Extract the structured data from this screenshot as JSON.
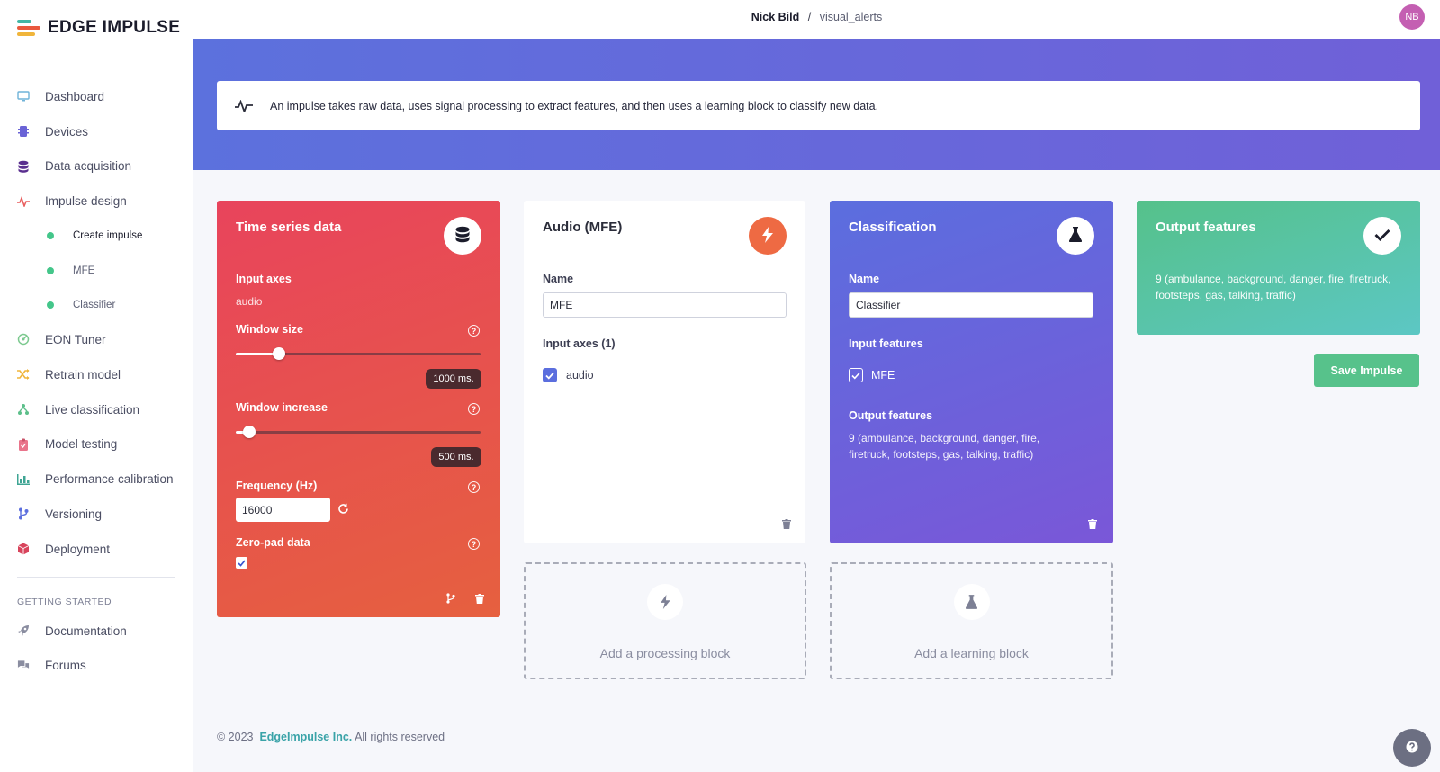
{
  "app": {
    "logo_text": "EDGE IMPULSE"
  },
  "nav": {
    "items": [
      {
        "label": "Dashboard",
        "icon": "monitor-icon"
      },
      {
        "label": "Devices",
        "icon": "chip-icon"
      },
      {
        "label": "Data acquisition",
        "icon": "database-icon"
      },
      {
        "label": "Impulse design",
        "icon": "pulse-icon"
      }
    ],
    "sub_items": [
      {
        "label": "Create impulse",
        "active": true
      },
      {
        "label": "MFE",
        "active": false
      },
      {
        "label": "Classifier",
        "active": false
      }
    ],
    "items2": [
      {
        "label": "EON Tuner",
        "icon": "target-icon"
      },
      {
        "label": "Retrain model",
        "icon": "shuffle-icon"
      },
      {
        "label": "Live classification",
        "icon": "branch-icon"
      },
      {
        "label": "Model testing",
        "icon": "clipboard-icon"
      },
      {
        "label": "Performance calibration",
        "icon": "chart-icon"
      },
      {
        "label": "Versioning",
        "icon": "git-icon"
      },
      {
        "label": "Deployment",
        "icon": "box-icon"
      }
    ],
    "section_heading": "GETTING STARTED",
    "items3": [
      {
        "label": "Documentation",
        "icon": "rocket-icon"
      },
      {
        "label": "Forums",
        "icon": "chat-icon"
      }
    ]
  },
  "topbar": {
    "user": "Nick Bild",
    "separator": "/",
    "project": "visual_alerts",
    "avatar_initials": "NB"
  },
  "info_banner": {
    "text": "An impulse takes raw data, uses signal processing to extract features, and then uses a learning block to classify new data."
  },
  "time_series": {
    "title": "Time series data",
    "input_axes_label": "Input axes",
    "input_axes_value": "audio",
    "window_size_label": "Window size",
    "window_size_value": "1000 ms.",
    "window_size_fraction": 0.18,
    "window_increase_label": "Window increase",
    "window_increase_value": "500 ms.",
    "window_increase_fraction": 0.05,
    "frequency_label": "Frequency (Hz)",
    "frequency_value": "16000",
    "zero_pad_label": "Zero-pad data",
    "zero_pad_checked": true
  },
  "processing": {
    "title": "Audio (MFE)",
    "name_label": "Name",
    "name_value": "MFE",
    "input_axes_label": "Input axes (1)",
    "axis_option": "audio"
  },
  "learning": {
    "title": "Classification",
    "name_label": "Name",
    "name_value": "Classifier",
    "input_features_label": "Input features",
    "input_feature_option": "MFE",
    "output_features_label": "Output features",
    "output_features_text": "9 (ambulance, background, danger, fire, firetruck, footsteps, gas, talking, traffic)"
  },
  "output": {
    "title": "Output features",
    "text": "9 (ambulance, background, danger, fire, firetruck, footsteps, gas, talking, traffic)"
  },
  "add_processing_label": "Add a processing block",
  "add_learning_label": "Add a learning block",
  "save_button": "Save Impulse",
  "footer": {
    "copyright": "© 2023",
    "company": "EdgeImpulse Inc.",
    "rights": "All rights reserved"
  },
  "colors": {
    "brand_accent": "#57c28b",
    "time_series_gradient": [
      "#e8445c",
      "#e66a3f"
    ],
    "processing_badge": "#ee6a43",
    "learning_gradient": [
      "#5b6ede",
      "#7a57d8"
    ],
    "output_gradient": [
      "#55c18a",
      "#5cc7c4"
    ],
    "hero_gradient": [
      "#5c71dd",
      "#7060d8"
    ]
  }
}
